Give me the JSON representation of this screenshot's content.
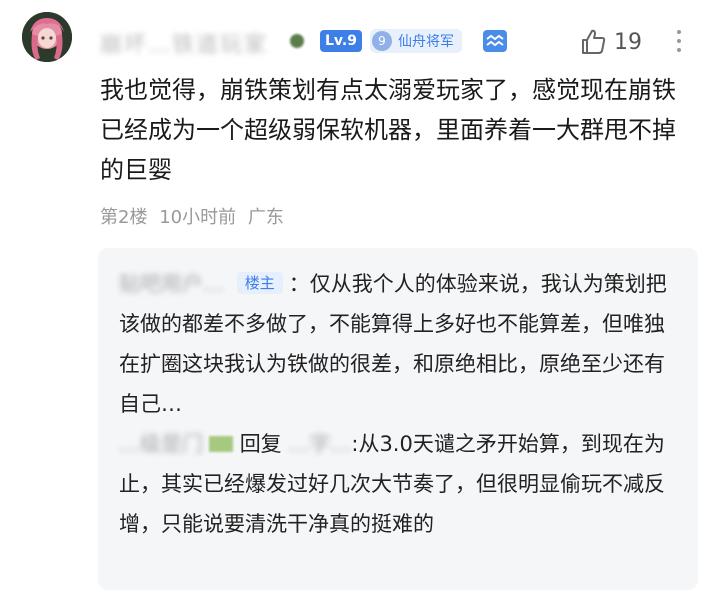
{
  "comment": {
    "username": "崩坏…铁道玩家",
    "level": "Lv.9",
    "title_badge_num": "9",
    "title_badge": "仙舟将军",
    "like_count": "19",
    "content": "我也觉得，崩铁策划有点太溺爱玩家了，感觉现在崩铁已经成为一个超级弱保软机器，里面养着一大群甩不掉的巨婴",
    "floor": "第2楼",
    "time": "10小时前",
    "location": "广东"
  },
  "replies": [
    {
      "author": "贴吧用户…",
      "owner_tag": "楼主",
      "text": "：仅从我个人的体验来说，我认为策划把该做的都差不多做了，不能算得上多好也不能算差，但唯独在扩圈这块我认为铁做的很差，和原绝相比，原绝至少还有自己…"
    },
    {
      "author": "…级是门",
      "reply_word": "回复",
      "reply_to": "…字…",
      "text": ":从3.0天谴之矛开始算，到现在为止，其实已经爆发过好几次大节奏了，但很明显偷玩不减反增，只能说要清洗干净真的挺难的"
    }
  ],
  "colors": {
    "accent": "#3d7ee9",
    "meta": "#999999",
    "reply_bg": "#f5f6f8"
  }
}
